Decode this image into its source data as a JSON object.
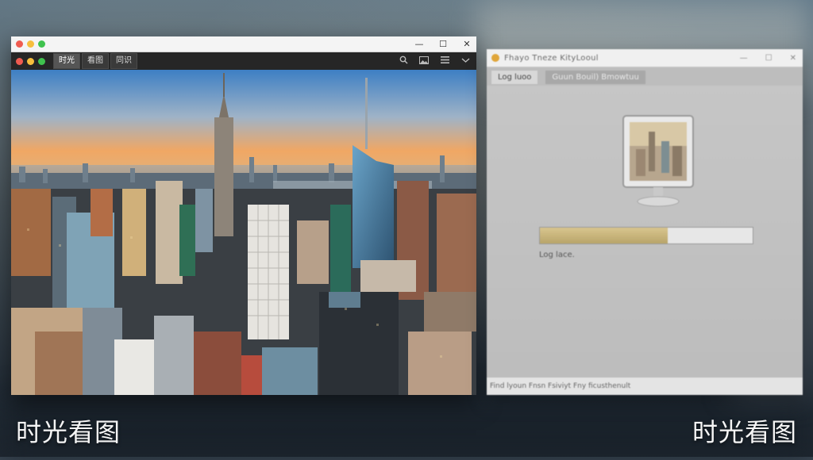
{
  "viewer": {
    "tabs": [
      {
        "label": "时光"
      },
      {
        "label": "看图"
      },
      {
        "label": "同识"
      }
    ],
    "icons": [
      "search-icon",
      "image-icon",
      "grid-icon",
      "more-icon"
    ],
    "colors": {
      "close": "#ef5b50",
      "minimize": "#f6be3d",
      "maximize": "#3fc24e"
    }
  },
  "loader": {
    "title": "Fhayo Tneze KityLooul",
    "tabs": [
      {
        "label": "Log luoo"
      },
      {
        "label": "Guun Bouil)  Bmowtuu"
      }
    ],
    "progress": 0.6,
    "status": "Log lace.",
    "footer": "Find lyoun Fnsn Fsiviyt Fny ficusthenult"
  },
  "captions": {
    "left": "时光看图",
    "right": "时光看图"
  }
}
